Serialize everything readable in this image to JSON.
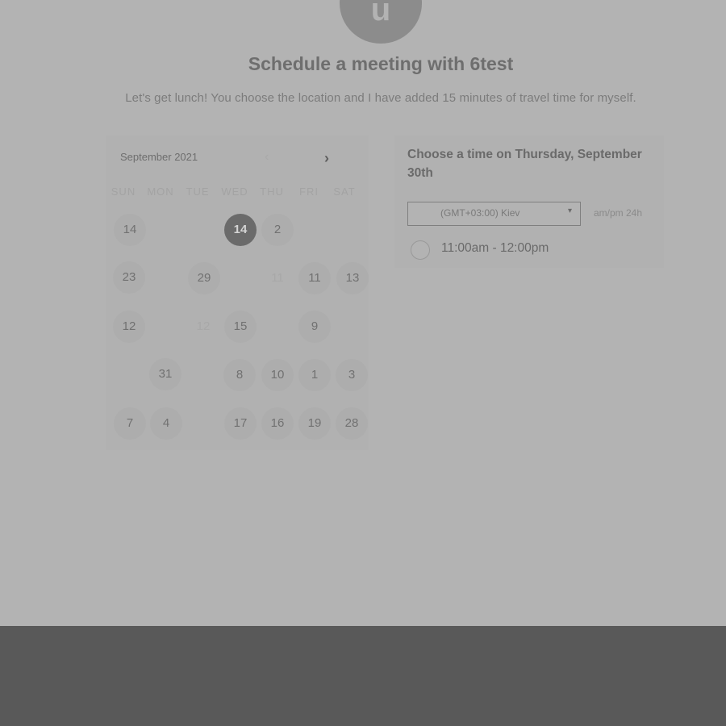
{
  "header": {
    "avatar_initial": "u",
    "title": "Schedule a meeting with 6test",
    "subtitle": "Let's get lunch! You choose the location and I have added 15 minutes of travel time for myself."
  },
  "calendar": {
    "month_label": "September 2021",
    "prev_icon": "chevron-left-icon",
    "next_icon": "chevron-right-icon",
    "prev_glyph": "‹",
    "next_glyph": "›",
    "weekdays": [
      "SUN",
      "MON",
      "TUE",
      "WED",
      "THU",
      "FRI",
      "SAT"
    ],
    "days": [
      {
        "label": "14",
        "state": "available"
      },
      {
        "label": "14",
        "state": "selected"
      },
      {
        "label": "2",
        "state": "available"
      },
      {
        "label": "23",
        "state": "available"
      },
      {
        "label": "29",
        "state": "available"
      },
      {
        "label": "11",
        "state": "faint"
      },
      {
        "label": "11",
        "state": "available"
      },
      {
        "label": "13",
        "state": "available"
      },
      {
        "label": "12",
        "state": "available"
      },
      {
        "label": "12",
        "state": "faint"
      },
      {
        "label": "15",
        "state": "available"
      },
      {
        "label": "9",
        "state": "available"
      },
      {
        "label": "31",
        "state": "available"
      },
      {
        "label": "8",
        "state": "available"
      },
      {
        "label": "10",
        "state": "available"
      },
      {
        "label": "1",
        "state": "available"
      },
      {
        "label": "3",
        "state": "available"
      },
      {
        "label": "7",
        "state": "available"
      },
      {
        "label": "4",
        "state": "available"
      },
      {
        "label": "17",
        "state": "available"
      },
      {
        "label": "16",
        "state": "available"
      },
      {
        "label": "19",
        "state": "available"
      },
      {
        "label": "28",
        "state": "available"
      }
    ]
  },
  "time_picker": {
    "heading": "Choose a time on Thursday, September 30th",
    "timezone_value": "(GMT+03:00) Kiev",
    "caret_glyph": "▾",
    "format_toggle": "am/pm  24h",
    "slots": [
      {
        "label": "11:00am - 12:00pm",
        "selected": false
      }
    ]
  },
  "colors": {
    "page_background": "#b3b3b3",
    "footer_band": "#595959",
    "selected_day": "#6b6b6b"
  }
}
